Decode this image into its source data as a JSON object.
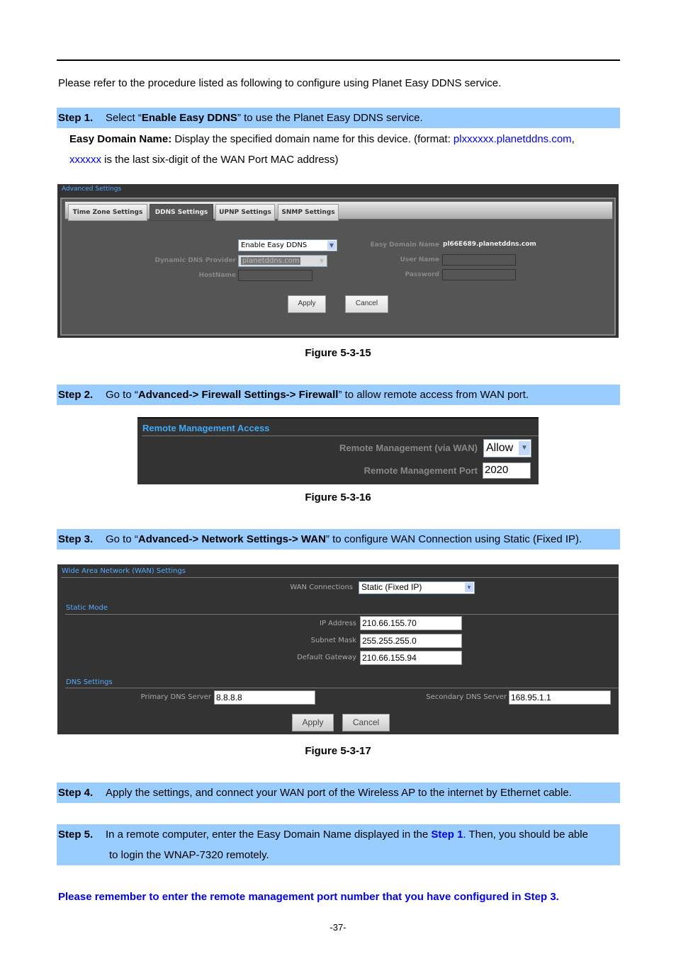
{
  "intro": "Please refer to the procedure listed as following to configure using Planet Easy DDNS service.",
  "step1": {
    "label": "Step 1.",
    "pre": "Select “",
    "bold": "Enable Easy DDNS",
    "post": "” to use the Planet Easy DDNS service.",
    "desc_bold": "Easy Domain Name:",
    "desc_text": " Display the specified domain name for this device. (format: ",
    "desc_link": "plxxxxxx.planetddns.com",
    "desc_comma": ",",
    "desc2_link": "xxxxxx",
    "desc2_text": " is the last six-digit of the WAN Port MAC address)"
  },
  "figure1": {
    "title": "Advanced Settings",
    "tabs": [
      "Time Zone Settings",
      "DDNS Settings",
      "UPNP Settings",
      "SNMP Settings"
    ],
    "active_tab": "DDNS Settings",
    "ddns_mode": "Enable Easy DDNS",
    "provider_label": "Dynamic DNS Provider",
    "provider_value": "planetddns.com",
    "hostname_label": "HostName",
    "easy_domain_label": "Easy Domain Name",
    "easy_domain_value": "pl66E689.planetddns.com",
    "username_label": "User Name",
    "password_label": "Password",
    "apply": "Apply",
    "cancel": "Cancel",
    "caption": "Figure 5-3-15"
  },
  "step2": {
    "label": "Step 2.",
    "pre": "Go to “",
    "bold": "Advanced-> Firewall Settings-> Firewall",
    "post": "” to allow remote access from WAN port."
  },
  "figure2": {
    "title": "Remote Management Access",
    "rm_label": "Remote Management (via WAN)",
    "rm_value": "Allow",
    "port_label": "Remote Management Port",
    "port_value": "2020",
    "caption": "Figure 5-3-16"
  },
  "step3": {
    "label": "Step 3.",
    "pre": "Go to “",
    "bold": "Advanced-> Network Settings-> WAN",
    "post": "” to configure WAN Connection using Static (Fixed IP)."
  },
  "figure3": {
    "title": "Wide Area Network (WAN) Settings",
    "wan_label": "WAN Connections",
    "wan_value": "Static (Fixed IP)",
    "static_title": "Static Mode",
    "ip_label": "IP Address",
    "ip_value": "210.66.155.70",
    "mask_label": "Subnet Mask",
    "mask_value": "255.255.255.0",
    "gw_label": "Default Gateway",
    "gw_value": "210.66.155.94",
    "dns_title": "DNS Settings",
    "dns1_label": "Primary DNS Server",
    "dns1_value": "8.8.8.8",
    "dns2_label": "Secondary DNS Server",
    "dns2_value": "168.95.1.1",
    "apply": "Apply",
    "cancel": "Cancel",
    "caption": "Figure 5-3-17"
  },
  "step4": {
    "label": "Step 4.",
    "text": "Apply the settings, and connect your WAN port of the Wireless AP to the internet by Ethernet cable."
  },
  "step5": {
    "label": "Step 5.",
    "pre": "In a remote computer, enter the Easy Domain Name displayed in the ",
    "link": "Step 1",
    "post": ". Then, you should be able",
    "line2": "to login the WNAP-7320 remotely."
  },
  "note": "Please remember to enter the remote management port number that you have configured in Step 3.",
  "page_number": "-37-"
}
